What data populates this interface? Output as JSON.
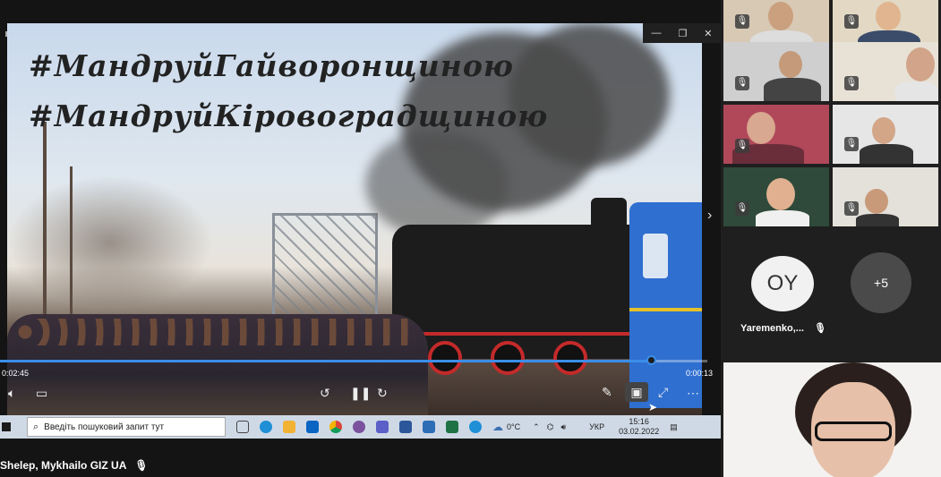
{
  "video": {
    "hashtag_1": "#МандруйГайворонщиною",
    "hashtag_2": "#МандруйКіровоградщиною",
    "elapsed": "0:02:45",
    "remaining": "0:00:13",
    "progress_fraction": 0.92,
    "window_buttons": [
      "—",
      "❐",
      "✕"
    ]
  },
  "taskbar": {
    "search_placeholder": "Введіть пошуковий запит тут",
    "weather": "0°C",
    "lang": "УКР",
    "time": "15:16",
    "date": "03.02.2022"
  },
  "shared_by": "Shelep, Mykhailo GIZ UA",
  "participants": {
    "initials_avatar": "OY",
    "initials_name": "Yaremenko,...",
    "more_count": "+5"
  },
  "colors": {
    "accent": "#3b8ee8",
    "taskbar_bg": "#cfd9e6",
    "avatar_bg": "#4a4a4a",
    "train_blue": "#2f6fd0"
  }
}
